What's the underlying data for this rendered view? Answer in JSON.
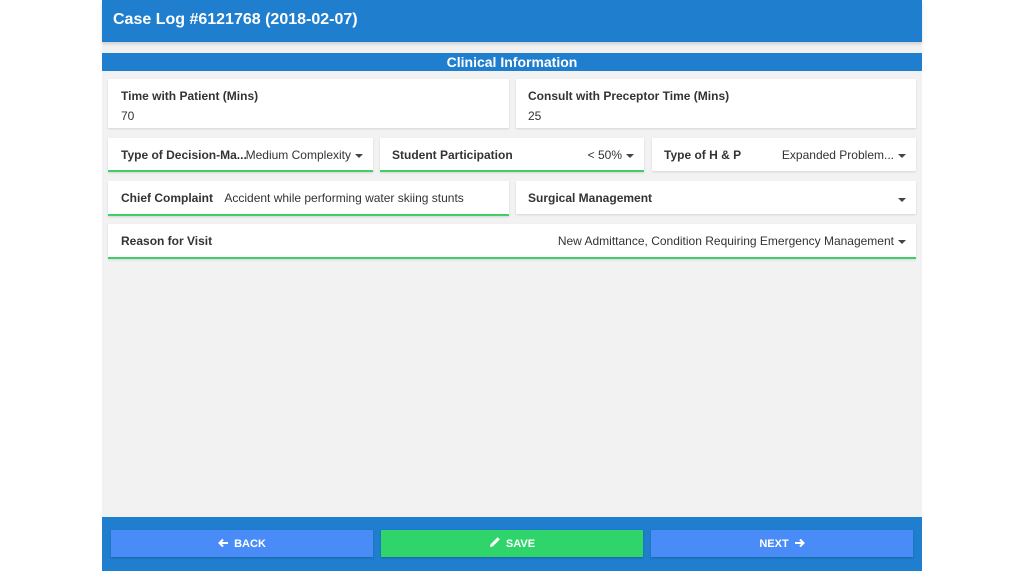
{
  "header": {
    "title": "Case Log #6121768 (2018-02-07)"
  },
  "section": {
    "title": "Clinical Information"
  },
  "fields": {
    "time_with_patient": {
      "label": "Time with Patient (Mins)",
      "value": "70"
    },
    "consult_preceptor": {
      "label": "Consult with Preceptor Time (Mins)",
      "value": "25"
    },
    "decision_making": {
      "label": "Type of Decision-Ma...",
      "value": "Medium Complexity"
    },
    "student_participation": {
      "label": "Student Participation",
      "value": "< 50%"
    },
    "type_hp": {
      "label": "Type of H & P",
      "value": "Expanded Problem..."
    },
    "chief_complaint": {
      "label": "Chief Complaint",
      "value": "Accident while performing water skiing stunts"
    },
    "surgical_management": {
      "label": "Surgical Management",
      "value": ""
    },
    "reason_for_visit": {
      "label": "Reason for Visit",
      "value": "New Admittance, Condition Requiring Emergency Management"
    }
  },
  "footer": {
    "back_label": "BACK",
    "save_label": "SAVE",
    "next_label": "NEXT"
  },
  "colors": {
    "primary": "#1f7ecd",
    "button_blue": "#4a8cf7",
    "button_green": "#2fd56b",
    "field_underline": "#3ecf6a"
  },
  "icons": {
    "back": "arrow-left-icon",
    "save": "pencil-icon",
    "next": "arrow-right-icon",
    "dropdown": "caret-down-icon"
  }
}
